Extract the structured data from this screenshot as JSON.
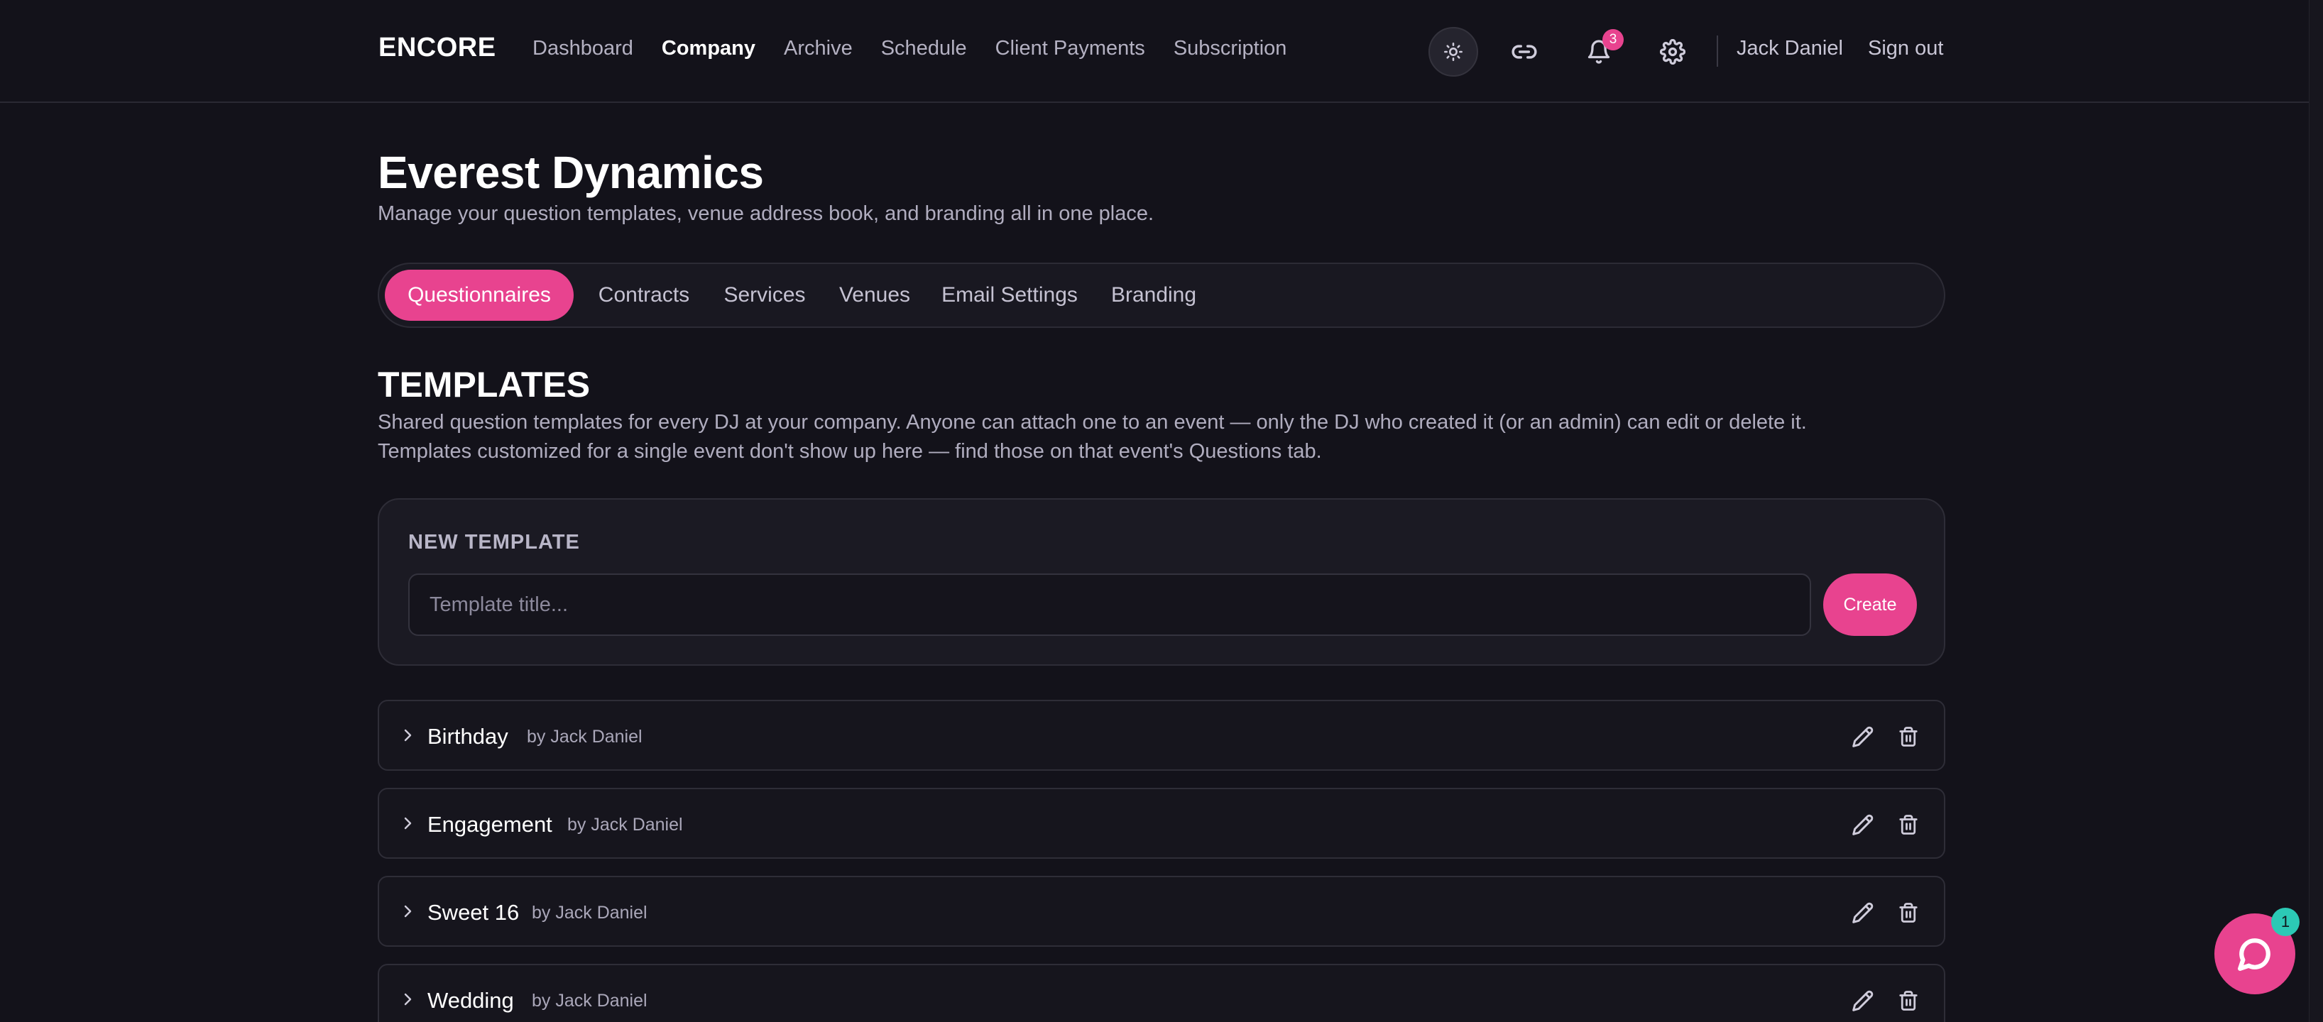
{
  "header": {
    "logo": "ENCORE",
    "nav": [
      {
        "label": "Dashboard",
        "active": false
      },
      {
        "label": "Company",
        "active": true
      },
      {
        "label": "Archive",
        "active": false
      },
      {
        "label": "Schedule",
        "active": false
      },
      {
        "label": "Client Payments",
        "active": false
      },
      {
        "label": "Subscription",
        "active": false
      }
    ],
    "icons": {
      "theme": "sun-icon",
      "link": "link-icon",
      "notifications": "bell-icon",
      "settings": "gear-icon"
    },
    "notification_count": "3",
    "user_name": "Jack Daniel",
    "sign_out_label": "Sign out"
  },
  "page": {
    "title": "Everest Dynamics",
    "subtitle": "Manage your question templates, venue address book, and branding all in one place."
  },
  "tabs": [
    {
      "label": "Questionnaires",
      "active": true
    },
    {
      "label": "Contracts",
      "active": false
    },
    {
      "label": "Services",
      "active": false
    },
    {
      "label": "Venues",
      "active": false
    },
    {
      "label": "Email Settings",
      "active": false
    },
    {
      "label": "Branding",
      "active": false
    }
  ],
  "templates_section": {
    "title": "TEMPLATES",
    "description_line1": "Shared question templates for every DJ at your company. Anyone can attach one to an event — only the DJ who created it (or an admin) can edit or delete it.",
    "description_line2": "Templates customized for a single event don't show up here — find those on that event's Questions tab."
  },
  "new_template": {
    "label": "NEW TEMPLATE",
    "input_value": "",
    "input_placeholder": "Template title...",
    "create_label": "Create"
  },
  "templates": [
    {
      "name": "Birthday",
      "author": "by Jack Daniel"
    },
    {
      "name": "Engagement",
      "author": "by Jack Daniel"
    },
    {
      "name": "Sweet 16",
      "author": "by Jack Daniel"
    },
    {
      "name": "Wedding",
      "author": "by Jack Daniel"
    }
  ],
  "chat": {
    "badge_count": "1"
  },
  "colors": {
    "background": "#13121a",
    "accent": "#e8438f",
    "chat_badge": "#2cc9b5"
  }
}
